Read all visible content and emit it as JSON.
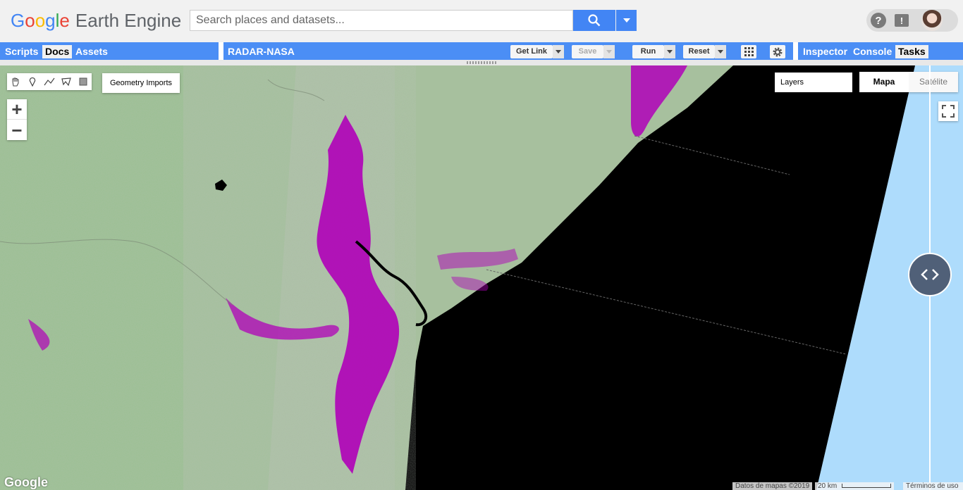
{
  "header": {
    "logo_letters": [
      "G",
      "o",
      "o",
      "g",
      "l",
      "e"
    ],
    "product": "Earth Engine",
    "search_placeholder": "Search places and datasets...",
    "icons": [
      "search-icon",
      "chevron-down-icon",
      "help-icon",
      "feedback-icon",
      "avatar"
    ]
  },
  "left_panel": {
    "tabs": [
      {
        "label": "Scripts",
        "active": false
      },
      {
        "label": "Docs",
        "active": true
      },
      {
        "label": "Assets",
        "active": false
      }
    ]
  },
  "editor": {
    "title": "RADAR-NASA",
    "get_link": "Get Link",
    "save": "Save",
    "run": "Run",
    "reset": "Reset"
  },
  "right_panel": {
    "tabs": [
      {
        "label": "Inspector",
        "active": false
      },
      {
        "label": "Console",
        "active": false
      },
      {
        "label": "Tasks",
        "active": true
      }
    ]
  },
  "map": {
    "geometry_imports": "Geometry Imports",
    "zoom_in": "+",
    "zoom_out": "−",
    "layers": "Layers",
    "map_types": [
      "Mapa",
      "Satélite"
    ],
    "selected_map_type": "Mapa",
    "watermark": "Google",
    "attribution": "Datos de mapas ©2019",
    "scale": "20 km",
    "terms": "Términos de uso",
    "colors": {
      "land": "#a7c09e",
      "flood": "#b000b8",
      "water": "#000000",
      "ocean": "#aedcfc"
    }
  }
}
